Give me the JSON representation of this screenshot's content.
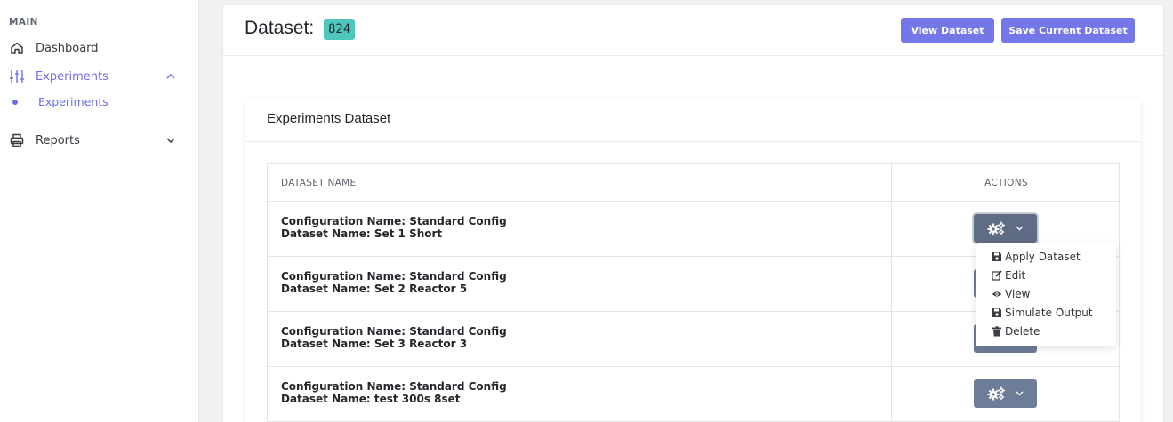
{
  "sidebar": {
    "heading": "MAIN",
    "items": [
      {
        "label": "Dashboard",
        "icon": "home-icon"
      },
      {
        "label": "Experiments",
        "icon": "sliders-icon",
        "expanded": true
      },
      {
        "label": "Reports",
        "icon": "printer-icon",
        "expanded": false
      }
    ],
    "sub_items": [
      {
        "label": "Experiments"
      }
    ]
  },
  "header": {
    "title": "Dataset:",
    "dataset_id": "824",
    "view_button": "View Dataset",
    "save_button": "Save Current Dataset"
  },
  "panel": {
    "title": "Experiments Dataset",
    "columns": [
      "DATASET NAME",
      "ACTIONS"
    ],
    "rows": [
      {
        "config": "Configuration Name: Standard Config",
        "dataset": "Dataset Name: Set 1 Short"
      },
      {
        "config": "Configuration Name: Standard Config",
        "dataset": "Dataset Name: Set 2 Reactor 5"
      },
      {
        "config": "Configuration Name: Standard Config",
        "dataset": "Dataset Name: Set 3 Reactor 3"
      },
      {
        "config": "Configuration Name: Standard Config",
        "dataset": "Dataset Name: test 300s 8set"
      }
    ]
  },
  "dropdown_menu": {
    "items": [
      {
        "label": "Apply Dataset",
        "icon": "save-icon"
      },
      {
        "label": "Edit",
        "icon": "edit-icon"
      },
      {
        "label": "View",
        "icon": "eye-icon"
      },
      {
        "label": "Simulate Output",
        "icon": "save-icon"
      },
      {
        "label": "Delete",
        "icon": "trash-icon"
      }
    ]
  },
  "colors": {
    "accent": "#7377e8",
    "badge": "#4fc6bd",
    "action_button": "#6d7c97"
  }
}
